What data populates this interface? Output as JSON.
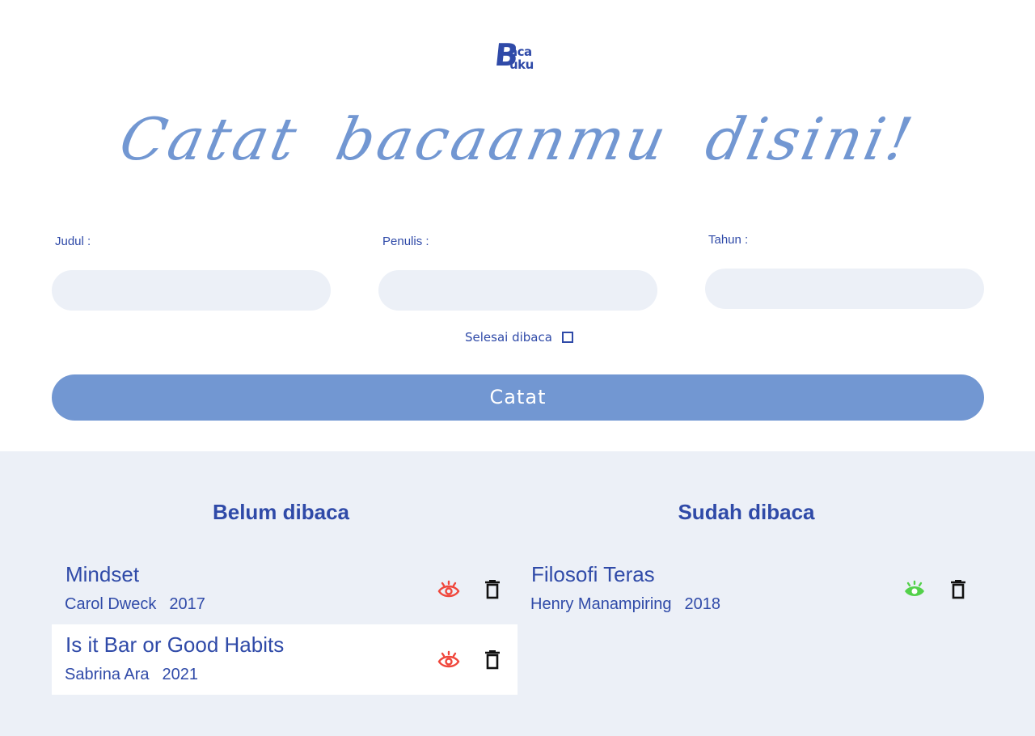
{
  "logo": {
    "initial": "B",
    "line1": "aca",
    "line2": "uku"
  },
  "hero": {
    "text": "Catat bacaanmu disini!"
  },
  "form": {
    "judul_label": "Judul :",
    "penulis_label": "Penulis :",
    "tahun_label": "Tahun :",
    "judul_value": "",
    "penulis_value": "",
    "tahun_value": "",
    "selesai_label": "Selesai dibaca",
    "selesai_checked": false,
    "submit_label": "Catat"
  },
  "unread": {
    "title": "Belum dibaca",
    "books": [
      {
        "title": "Mindset",
        "author": "Carol Dweck",
        "year": "2017"
      },
      {
        "title": "Is it Bar or Good Habits",
        "author": "Sabrina Ara",
        "year": "2021"
      }
    ]
  },
  "read": {
    "title": "Sudah dibaca",
    "books": [
      {
        "title": "Filosofi Teras",
        "author": "Henry Manampiring",
        "year": "2018"
      }
    ]
  },
  "icons": {
    "toggle_unread": "eye-icon",
    "toggle_read": "eye-icon",
    "delete": "trash-icon"
  },
  "colors": {
    "brand": "#2f4aa8",
    "accent": "#7297d2",
    "panel": "#ecf0f7",
    "eye_unread": "#f0473c",
    "eye_read": "#53d14a",
    "trash": "#111111"
  }
}
